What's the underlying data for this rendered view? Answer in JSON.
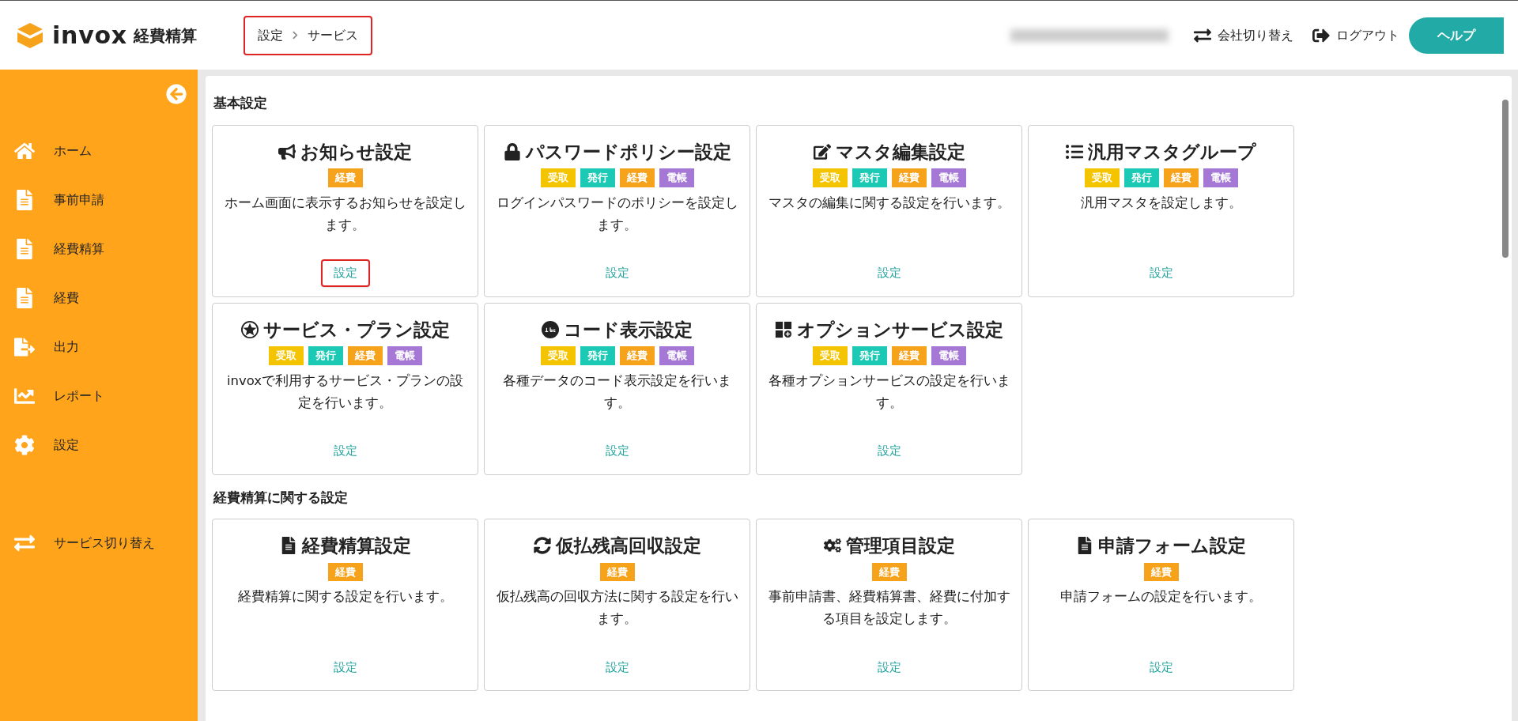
{
  "header": {
    "logo_text": "invox",
    "logo_subtext": "経費精算",
    "breadcrumb": {
      "highlighted": true,
      "items": [
        "設定",
        "サービス"
      ]
    },
    "actions": [
      "会社切り替え",
      "ログアウト"
    ],
    "help_button": "ヘルプ"
  },
  "sidebar": {
    "items": [
      "ホーム",
      "事前申請",
      "経費精算",
      "経費",
      "出力",
      "レポート",
      "設定"
    ],
    "footer_item": "サービス切り替え"
  },
  "sections": [
    {
      "title": "基本設定",
      "cards": [
        {
          "title": "お知らせ設定",
          "tags": [
            {
              "label": "経費",
              "color": "#f7a21b"
            }
          ],
          "description": "ホーム画面に表示するお知らせを設定します。",
          "link": "設定",
          "link_highlighted": true
        },
        {
          "title": "パスワードポリシー設定",
          "tags": [
            {
              "label": "受取",
              "color": "#f5c400"
            },
            {
              "label": "発行",
              "color": "#1cc9b5"
            },
            {
              "label": "経費",
              "color": "#f7a21b"
            },
            {
              "label": "電帳",
              "color": "#a678d6"
            }
          ],
          "description": "ログインパスワードのポリシーを設定します。",
          "link": "設定",
          "link_highlighted": false
        },
        {
          "title": "マスタ編集設定",
          "tags": [
            {
              "label": "受取",
              "color": "#f5c400"
            },
            {
              "label": "発行",
              "color": "#1cc9b5"
            },
            {
              "label": "経費",
              "color": "#f7a21b"
            },
            {
              "label": "電帳",
              "color": "#a678d6"
            }
          ],
          "description": "マスタの編集に関する設定を行います。",
          "link": "設定",
          "link_highlighted": false
        },
        {
          "title": "汎用マスタグループ",
          "tags": [
            {
              "label": "受取",
              "color": "#f5c400"
            },
            {
              "label": "発行",
              "color": "#1cc9b5"
            },
            {
              "label": "経費",
              "color": "#f7a21b"
            },
            {
              "label": "電帳",
              "color": "#a678d6"
            }
          ],
          "description": "汎用マスタを設定します。",
          "link": "設定",
          "link_highlighted": false
        },
        {
          "title": "サービス・プラン設定",
          "tags": [
            {
              "label": "受取",
              "color": "#f5c400"
            },
            {
              "label": "発行",
              "color": "#1cc9b5"
            },
            {
              "label": "経費",
              "color": "#f7a21b"
            },
            {
              "label": "電帳",
              "color": "#a678d6"
            }
          ],
          "description": "invoxで利用するサービス・プランの設定を行います。",
          "link": "設定",
          "link_highlighted": false
        },
        {
          "title": "コード表示設定",
          "tags": [
            {
              "label": "受取",
              "color": "#f5c400"
            },
            {
              "label": "発行",
              "color": "#1cc9b5"
            },
            {
              "label": "経費",
              "color": "#f7a21b"
            },
            {
              "label": "電帳",
              "color": "#a678d6"
            }
          ],
          "description": "各種データのコード表示設定を行います。",
          "link": "設定",
          "link_highlighted": false
        },
        {
          "title": "オプションサービス設定",
          "tags": [
            {
              "label": "受取",
              "color": "#f5c400"
            },
            {
              "label": "発行",
              "color": "#1cc9b5"
            },
            {
              "label": "経費",
              "color": "#f7a21b"
            },
            {
              "label": "電帳",
              "color": "#a678d6"
            }
          ],
          "description": "各種オプションサービスの設定を行います。",
          "link": "設定",
          "link_highlighted": false
        }
      ]
    },
    {
      "title": "経費精算に関する設定",
      "cards": [
        {
          "title": "経費精算設定",
          "tags": [
            {
              "label": "経費",
              "color": "#f7a21b"
            }
          ],
          "description": "経費精算に関する設定を行います。",
          "link": "設定",
          "link_highlighted": false
        },
        {
          "title": "仮払残高回収設定",
          "tags": [
            {
              "label": "経費",
              "color": "#f7a21b"
            }
          ],
          "description": "仮払残高の回収方法に関する設定を行います。",
          "link": "設定",
          "link_highlighted": false
        },
        {
          "title": "管理項目設定",
          "tags": [
            {
              "label": "経費",
              "color": "#f7a21b"
            }
          ],
          "description": "事前申請書、経費精算書、経費に付加する項目を設定します。",
          "link": "設定",
          "link_highlighted": false
        },
        {
          "title": "申請フォーム設定",
          "tags": [
            {
              "label": "経費",
              "color": "#f7a21b"
            }
          ],
          "description": "申請フォームの設定を行います。",
          "link": "設定",
          "link_highlighted": false
        }
      ]
    }
  ]
}
